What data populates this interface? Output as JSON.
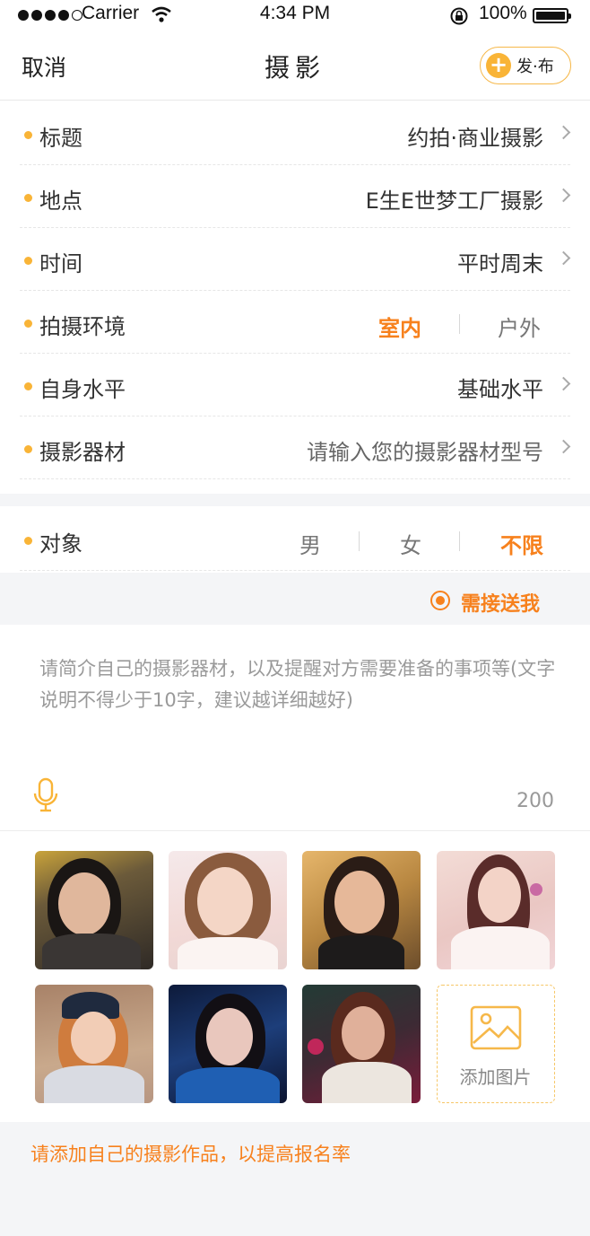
{
  "status_bar": {
    "carrier": "Carrier",
    "time": "4:34 PM",
    "battery": "100%",
    "battery_level": 1.0
  },
  "nav": {
    "cancel": "取消",
    "title": "摄影",
    "publish_label": "发·布",
    "publish_icon": "plus-icon"
  },
  "form": {
    "title_label": "标题",
    "title_value": "约拍·商业摄影",
    "location_label": "地点",
    "location_value": "E生E世梦工厂摄影",
    "time_label": "时间",
    "time_value": "平时周末",
    "environment_label": "拍摄环境",
    "environment_options": [
      "室内",
      "户外"
    ],
    "environment_selected": "室内",
    "level_label": "自身水平",
    "level_value": "基础水平",
    "equipment_label": "摄影器材",
    "equipment_placeholder": "请输入您的摄影器材型号",
    "target_label": "对象",
    "target_options": [
      "男",
      "女",
      "不限"
    ],
    "target_selected": "不限"
  },
  "pickup": {
    "label": "需接送我",
    "checked": true
  },
  "description": {
    "placeholder": "请简介自己的摄影器材，以及提醒对方需要准备的事项等(文字说明不得少于10字，建议越详细越好)",
    "char_limit": "200",
    "mic_icon": "microphone-icon"
  },
  "photos": {
    "add_label": "添加图片",
    "add_icon": "image-icon"
  },
  "footer": {
    "tip": "请添加自己的摄影作品，以提高报名率"
  },
  "colors": {
    "accent": "#f7811d",
    "bullet": "#f9b437",
    "background_gray": "#f4f5f7"
  }
}
